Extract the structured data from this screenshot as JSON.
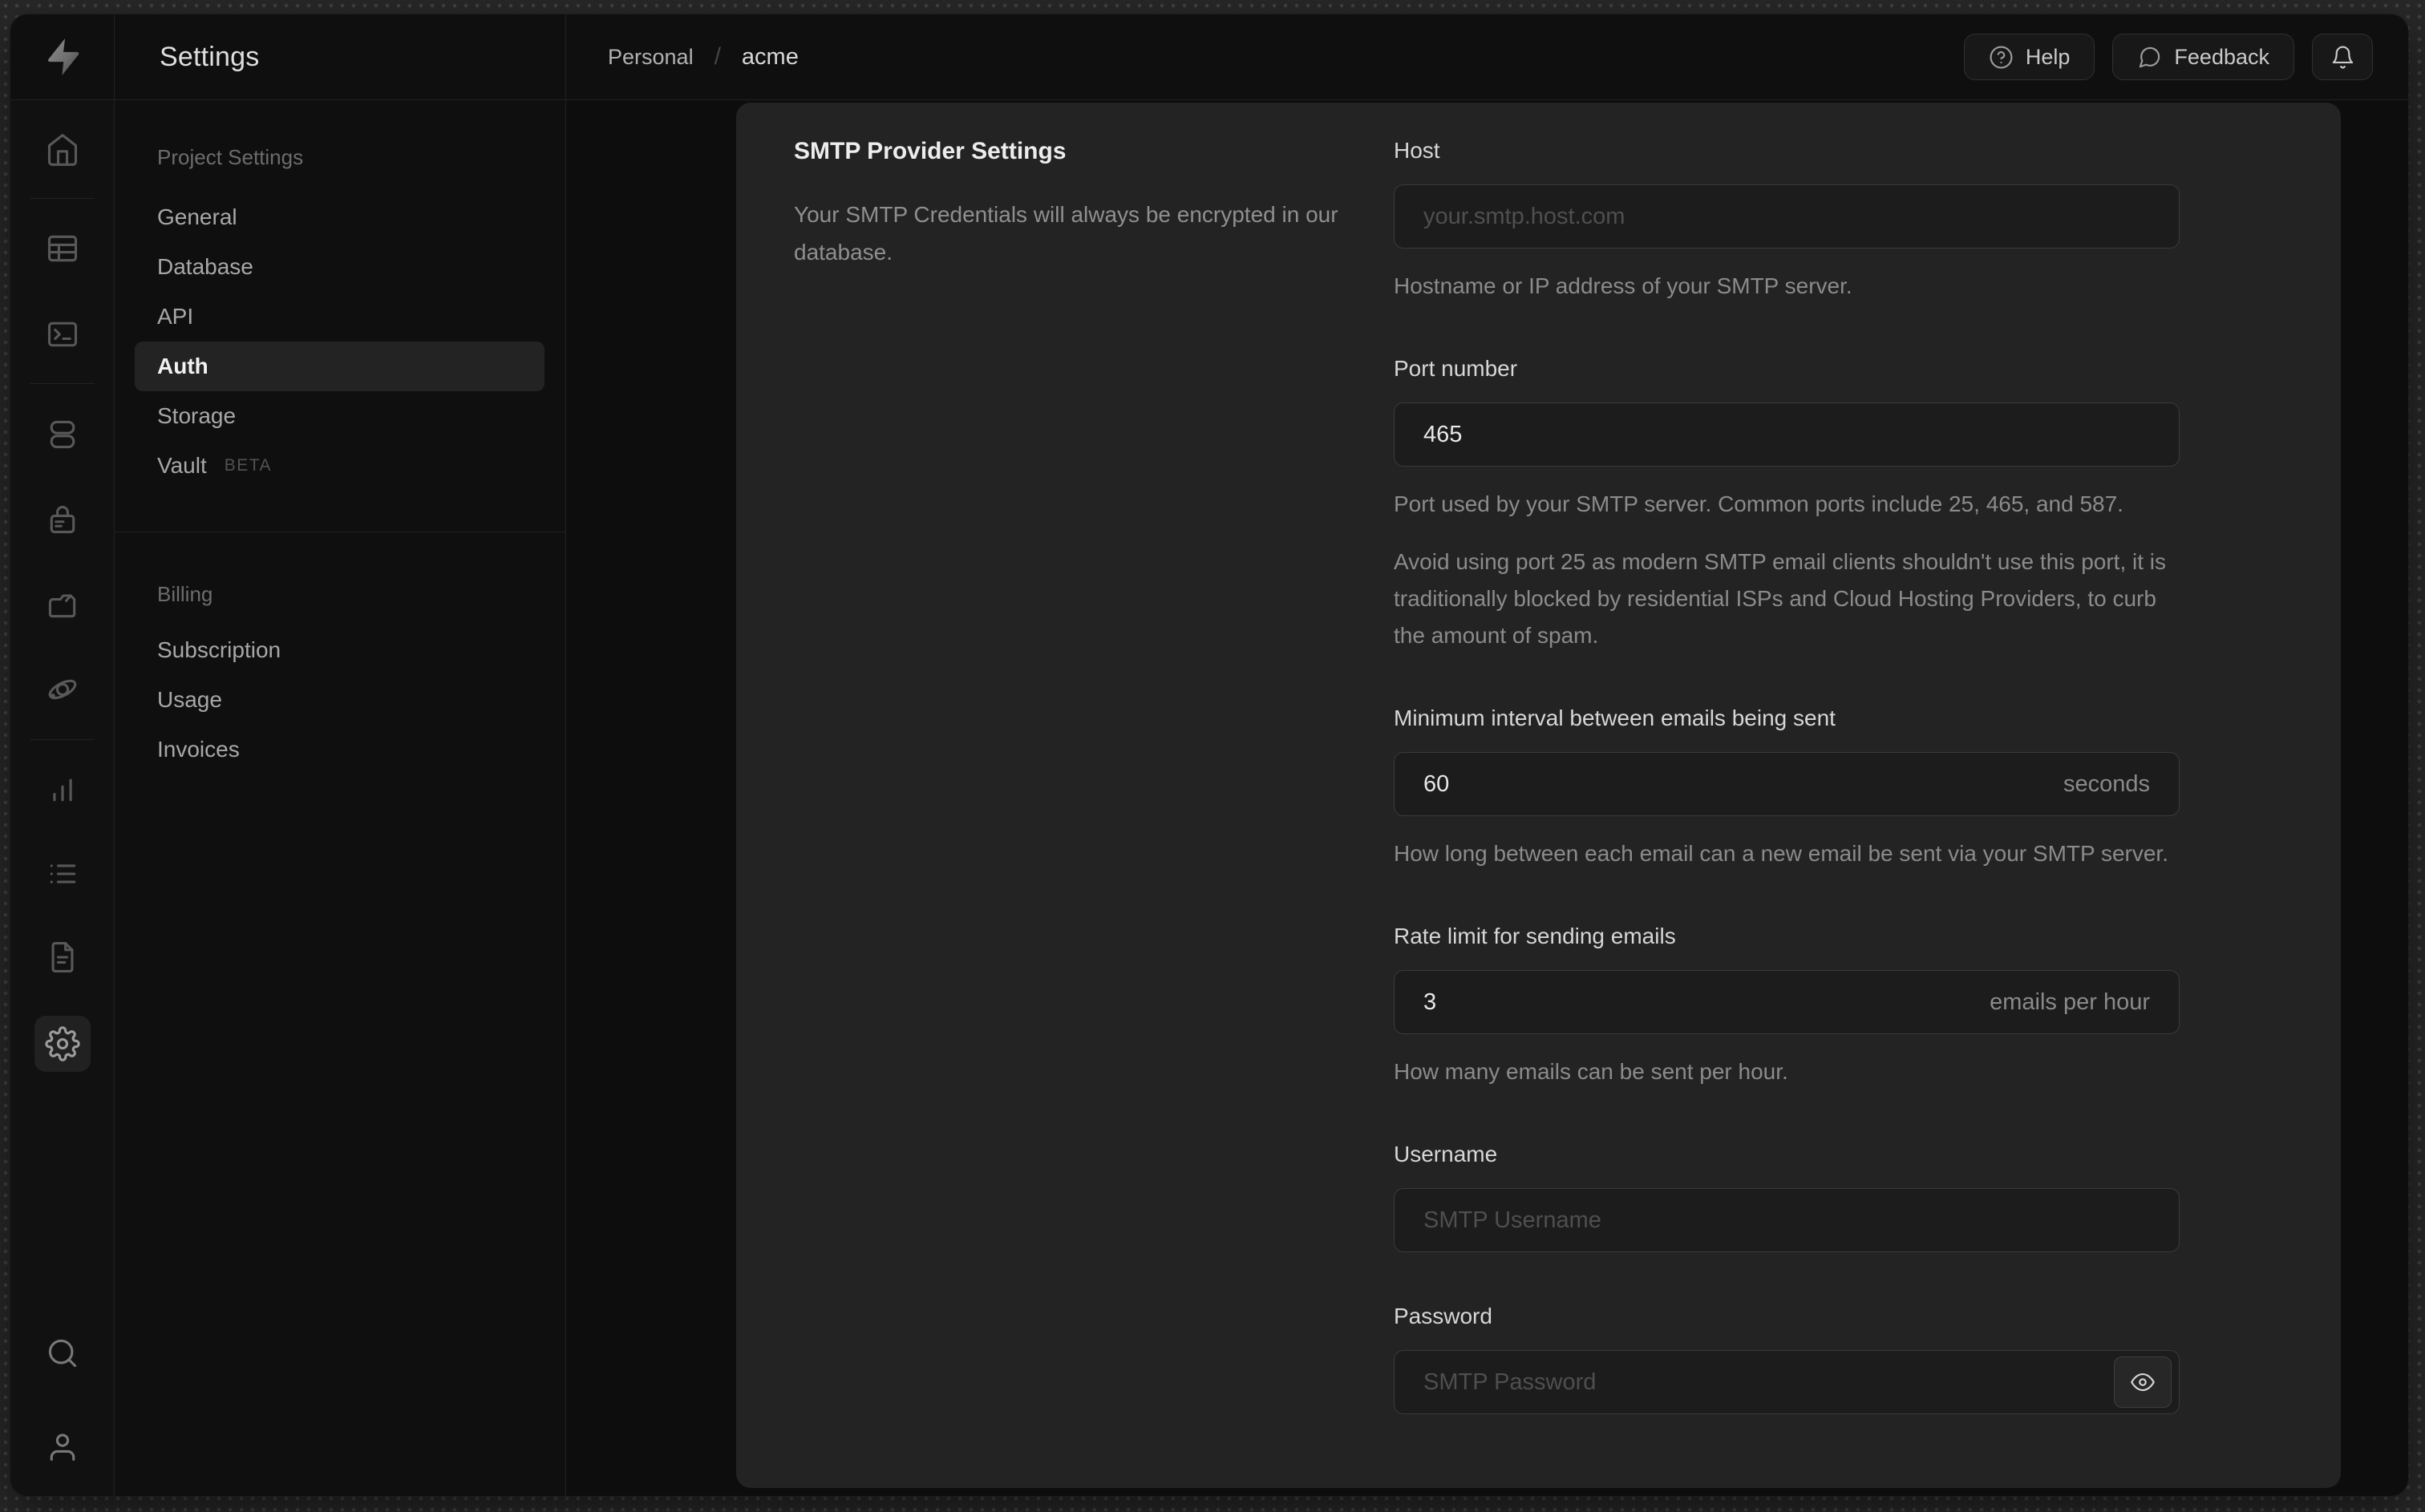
{
  "header": {
    "app_section_title": "Settings",
    "breadcrumb": {
      "org": "Personal",
      "separator": "/",
      "project": "acme"
    },
    "actions": {
      "help_label": "Help",
      "feedback_label": "Feedback",
      "bell_icon": "notifications-bell-icon"
    }
  },
  "icon_rail": {
    "items": [
      "home-icon",
      "table-editor-icon",
      "sql-editor-icon",
      "database-icon",
      "authentication-icon",
      "storage-icon",
      "edge-functions-icon",
      "reports-icon",
      "logs-icon",
      "api-docs-icon",
      "project-settings-gear-icon",
      "search-icon",
      "user-icon"
    ],
    "active_item": "project-settings-gear-icon"
  },
  "sidebar": {
    "sections": [
      {
        "title": "Project Settings",
        "items": [
          {
            "label": "General"
          },
          {
            "label": "Database"
          },
          {
            "label": "API"
          },
          {
            "label": "Auth",
            "active": true
          },
          {
            "label": "Storage"
          },
          {
            "label": "Vault",
            "badge": "BETA"
          }
        ]
      },
      {
        "title": "Billing",
        "items": [
          {
            "label": "Subscription"
          },
          {
            "label": "Usage"
          },
          {
            "label": "Invoices"
          }
        ]
      }
    ]
  },
  "content": {
    "section_title": "SMTP Provider Settings",
    "section_description": "Your SMTP Credentials will always be encrypted in our database.",
    "fields": {
      "host": {
        "label": "Host",
        "value": "",
        "placeholder": "your.smtp.host.com",
        "help": "Hostname or IP address of your SMTP server."
      },
      "port": {
        "label": "Port number",
        "value": "465",
        "placeholder": "",
        "help": "Port used by your SMTP server. Common ports include 25, 465, and 587.",
        "help2": "Avoid using port 25 as modern SMTP email clients shouldn't use this port, it is traditionally blocked by residential ISPs and Cloud Hosting Providers, to curb the amount of spam."
      },
      "interval": {
        "label": "Minimum interval between emails being sent",
        "value": "60",
        "unit": "seconds",
        "help": "How long between each email can a new email be sent via your SMTP server."
      },
      "rate": {
        "label": "Rate limit for sending emails",
        "value": "3",
        "unit": "emails per hour",
        "help": "How many emails can be sent per hour."
      },
      "username": {
        "label": "Username",
        "value": "",
        "placeholder": "SMTP Username"
      },
      "password": {
        "label": "Password",
        "value": "",
        "placeholder": "SMTP Password",
        "toggle_icon": "eye-icon"
      }
    }
  },
  "colors": {
    "desktop_bg": "#282828",
    "window_bg": "#0f0f0f",
    "panel_bg": "#232323",
    "active_item_bg": "#232323",
    "input_bg": "#1c1c1c",
    "input_border": "#3a3a3a",
    "muted_text": "#8b8b8b"
  }
}
